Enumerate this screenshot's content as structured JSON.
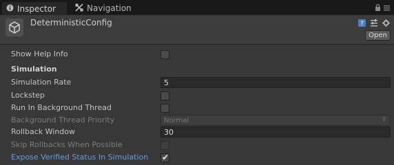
{
  "tabs": [
    {
      "label": "Inspector"
    },
    {
      "label": "Navigation"
    }
  ],
  "header": {
    "title": "DeterministicConfig",
    "open_label": "Open"
  },
  "rows": [
    {
      "label": "Show Help Info",
      "type": "toggle",
      "checked": false
    },
    {
      "label": "Simulation",
      "type": "section"
    },
    {
      "label": "Simulation Rate",
      "type": "int",
      "value": "5"
    },
    {
      "label": "Lockstep",
      "type": "toggle",
      "checked": false
    },
    {
      "label": "Run In Background Thread",
      "type": "toggle",
      "checked": false
    },
    {
      "label": "Background Thread Priority",
      "type": "enum",
      "value": "Normal",
      "disabled": true
    },
    {
      "label": "Rollback Window",
      "type": "int",
      "value": "30"
    },
    {
      "label": "Skip Rollbacks When Possible",
      "type": "toggle",
      "checked": false,
      "disabled": true
    },
    {
      "label": "Expose Verified Status In Simulation",
      "type": "toggle",
      "checked": true
    }
  ],
  "colors": {
    "background": "#383838",
    "highlight_label": "#6a9cdf"
  },
  "icons": {
    "inspector_tab": "info-icon",
    "navigation_tab": "navigation-icon",
    "lock": "lock-icon",
    "menu": "menu-icon",
    "object": "unity-logo-icon",
    "help": "help-icon",
    "preset": "preset-icon",
    "settings": "gear-icon"
  }
}
